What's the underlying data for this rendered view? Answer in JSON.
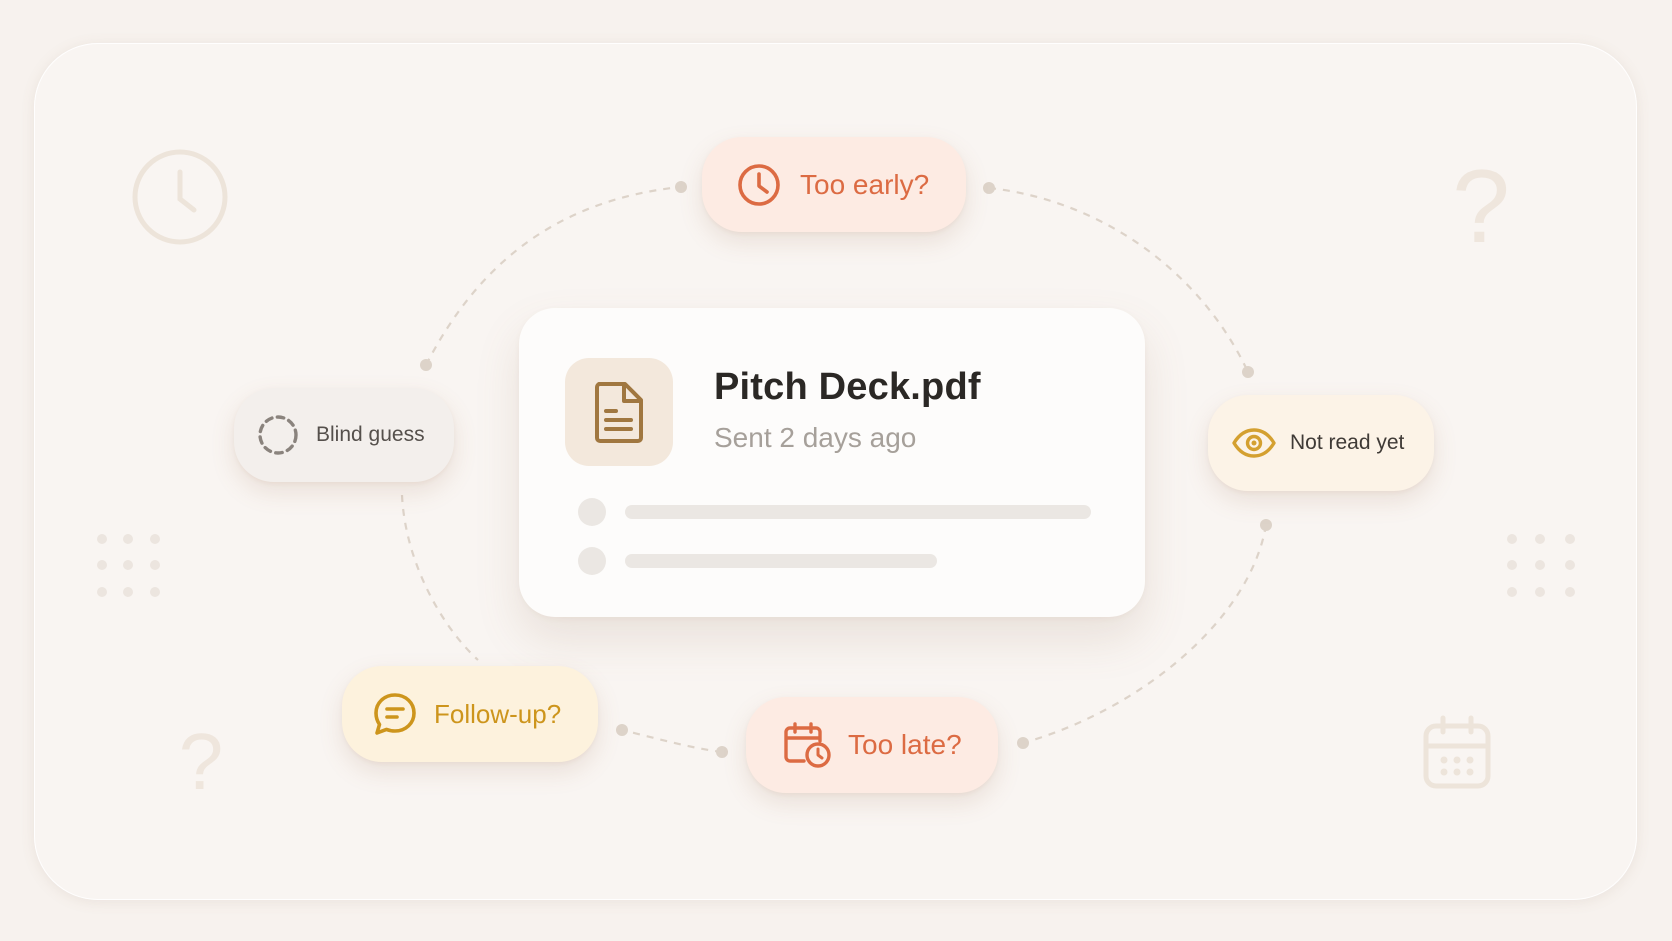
{
  "document_card": {
    "icon": "document-icon",
    "file_name": "Pitch Deck.pdf",
    "sent_status": "Sent 2 days ago"
  },
  "bubbles": {
    "too_early": {
      "label": "Too early?",
      "icon": "clock-icon",
      "color": "#dc6b43"
    },
    "blind_guess": {
      "label": "Blind guess",
      "icon": "dashed-circle-icon",
      "color": "#8a837d"
    },
    "not_read_yet": {
      "label": "Not read yet",
      "icon": "eye-icon",
      "color": "#d4a030"
    },
    "follow_up": {
      "label": "Follow-up?",
      "icon": "chat-bubble-icon",
      "color": "#cd951c"
    },
    "too_late": {
      "label": "Too late?",
      "icon": "calendar-clock-icon",
      "color": "#dc6b43"
    }
  },
  "background_decorations": [
    "clock-icon",
    "question-mark-icon",
    "dot-grid-icon",
    "calendar-icon"
  ]
}
